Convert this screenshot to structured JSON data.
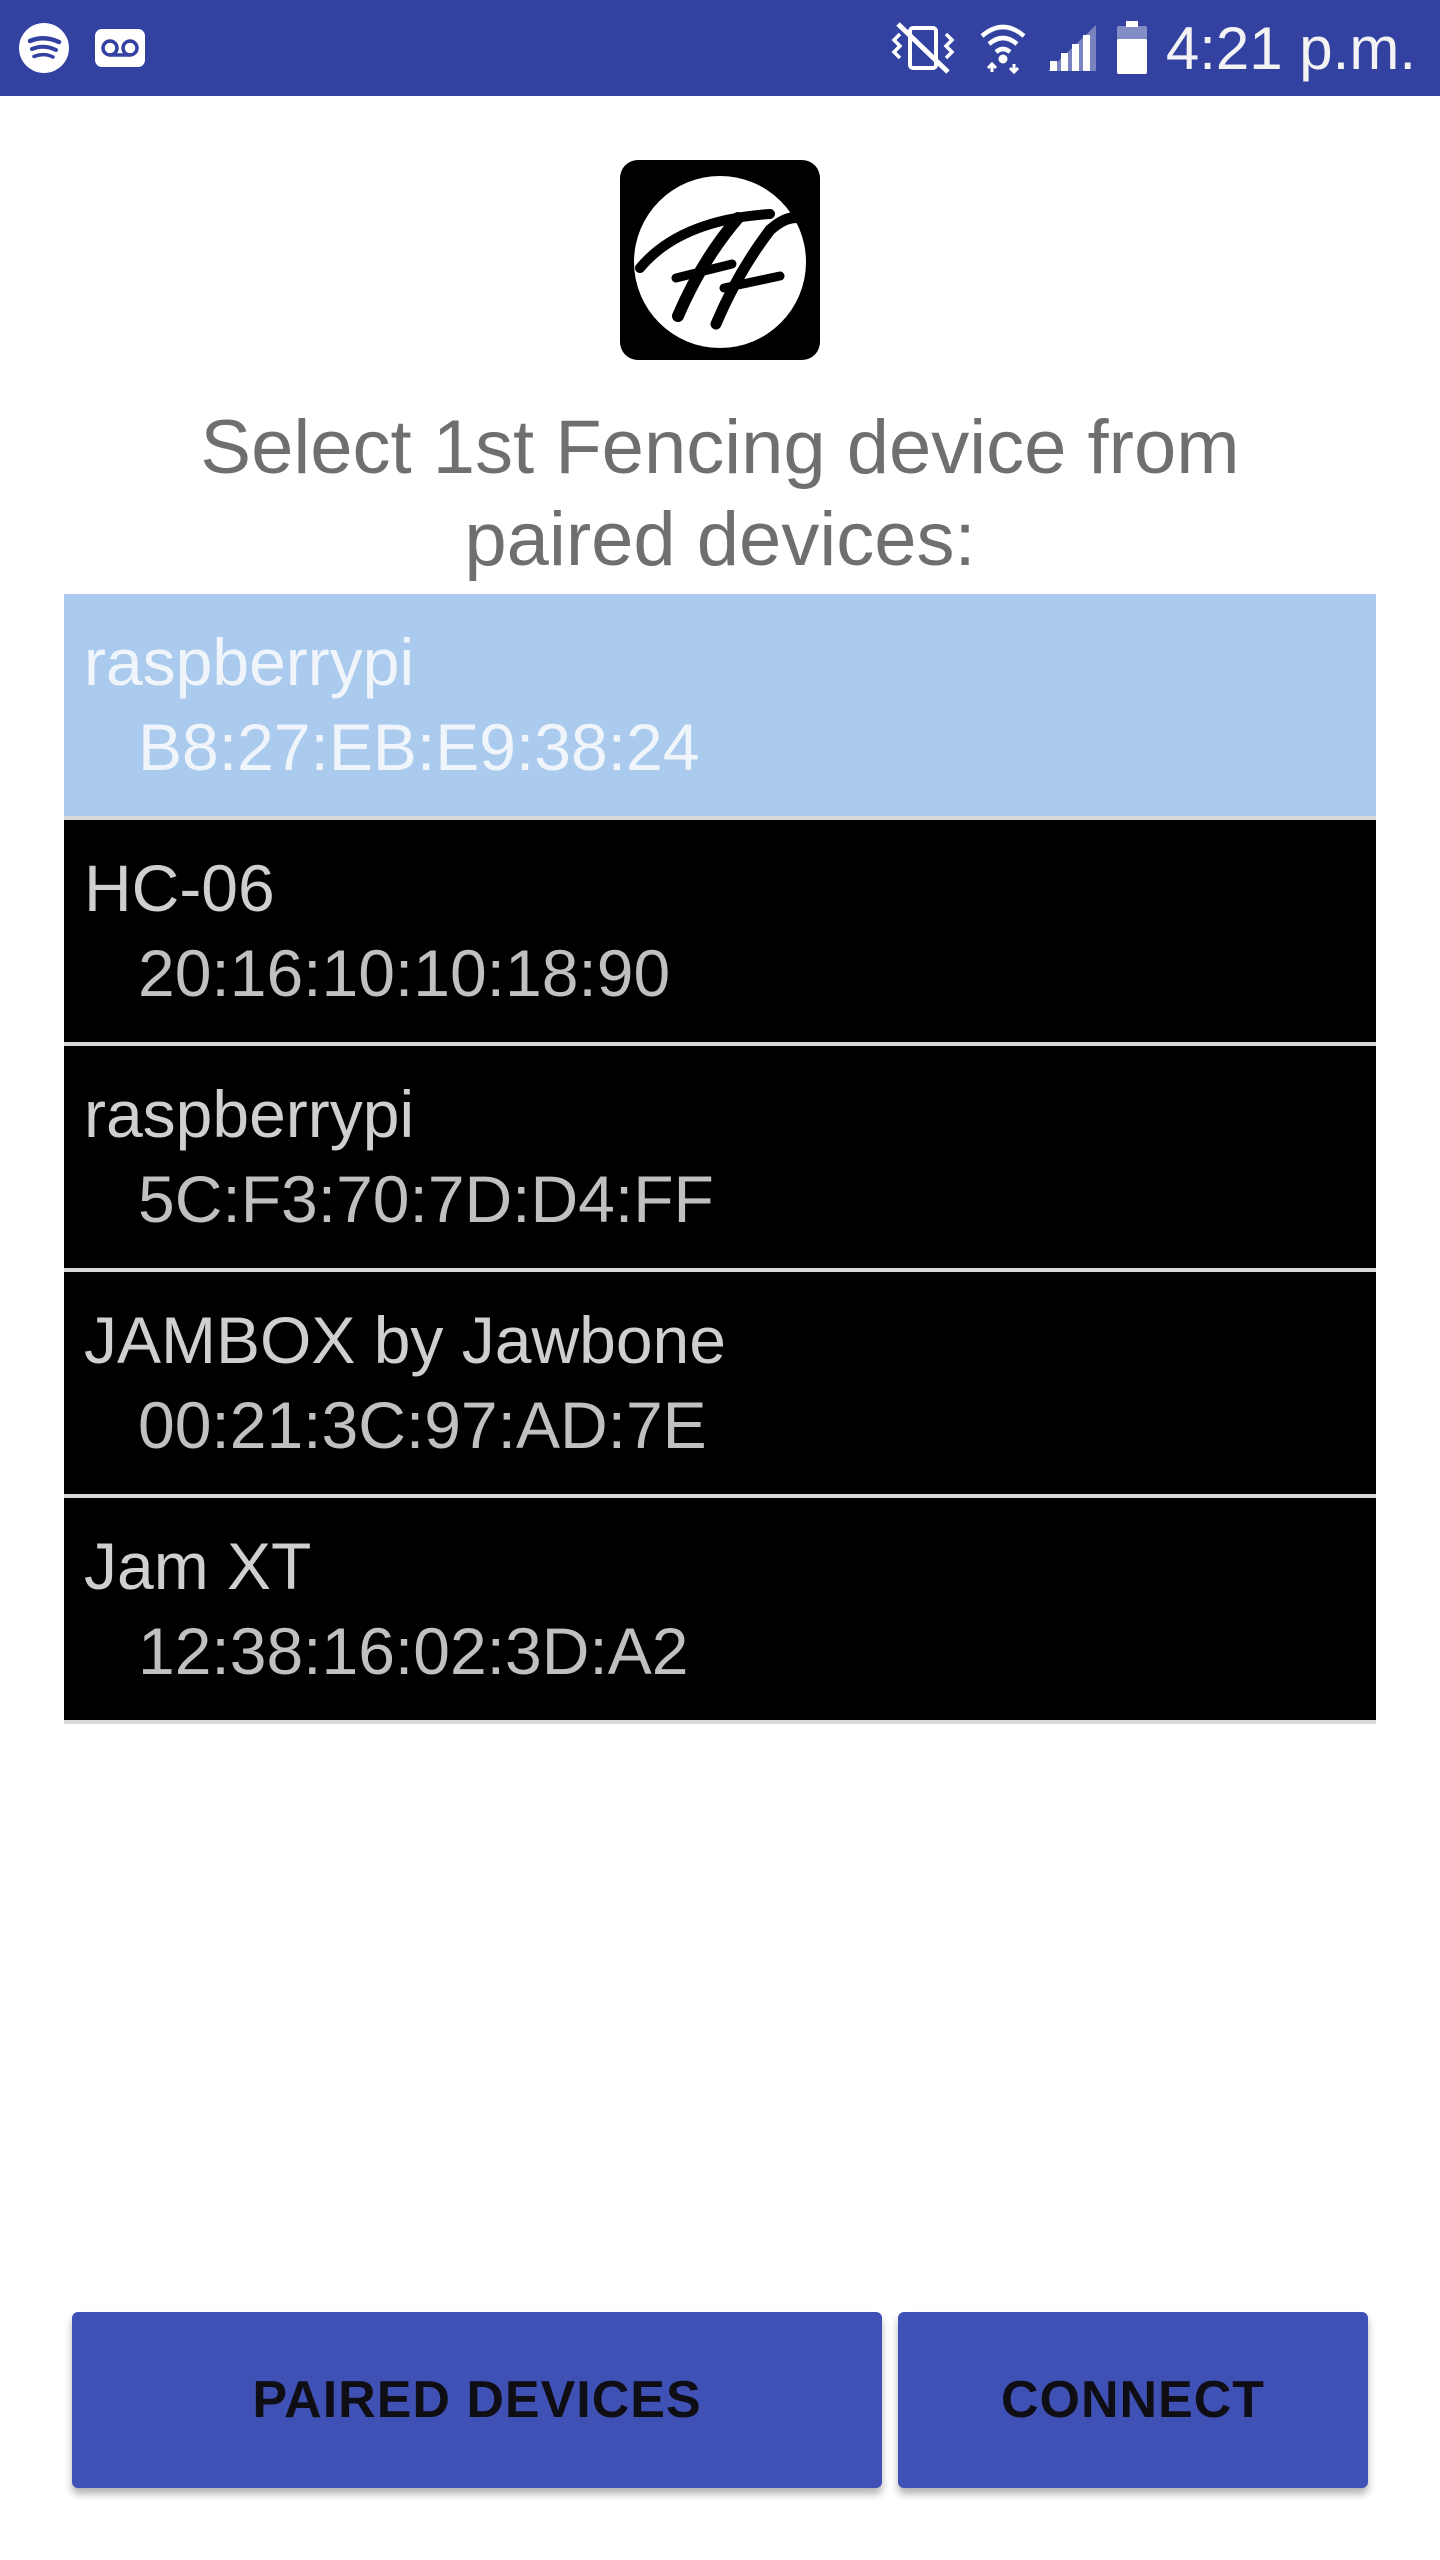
{
  "status_bar": {
    "time": "4:21 p.m.",
    "icons": [
      "spotify-icon",
      "voicemail-icon",
      "vibrate-mute-icon",
      "wifi-icon",
      "signal-icon",
      "battery-icon"
    ],
    "color": "#3341a0"
  },
  "logo": {
    "text": "FF"
  },
  "heading": {
    "line1": "Select 1st Fencing device from",
    "line2": "paired devices:"
  },
  "devices": [
    {
      "name": "raspberrypi",
      "address": "B8:27:EB:E9:38:24",
      "selected": true
    },
    {
      "name": "HC-06",
      "address": "20:16:10:10:18:90",
      "selected": false
    },
    {
      "name": "raspberrypi",
      "address": "5C:F3:70:7D:D4:FF",
      "selected": false
    },
    {
      "name": "JAMBOX by Jawbone",
      "address": "00:21:3C:97:AD:7E",
      "selected": false
    },
    {
      "name": "Jam XT",
      "address": "12:38:16:02:3D:A2",
      "selected": false
    }
  ],
  "buttons": {
    "paired_devices": "PAIRED DEVICES",
    "connect": "CONNECT"
  },
  "colors": {
    "accent": "#3f51b5",
    "selected_row": "#aacbee",
    "row_background": "#000000"
  }
}
